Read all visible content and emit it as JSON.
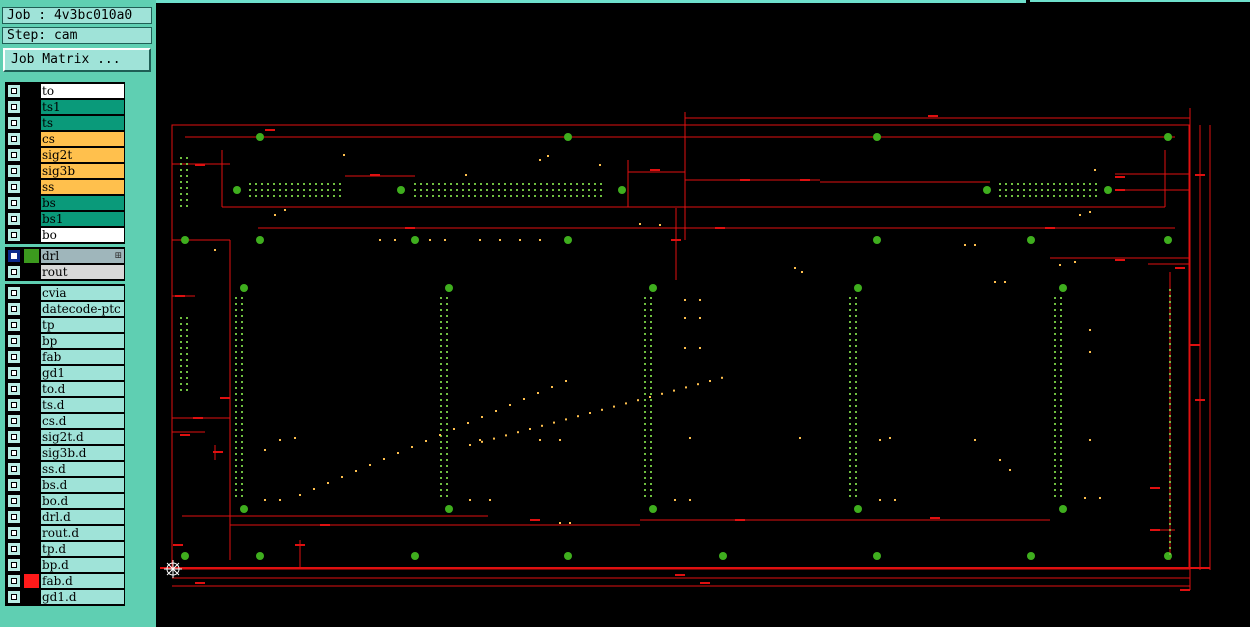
{
  "header": {
    "job_label": "Job : 4v3bc010a0",
    "step_label": "Step: cam",
    "job_matrix_button": "Job Matrix ..."
  },
  "layer_groups": [
    {
      "layers": [
        {
          "name": "to",
          "color": "#ffffff"
        },
        {
          "name": "ts1",
          "color": "#0a9a7a"
        },
        {
          "name": "ts",
          "color": "#0a9a7a"
        },
        {
          "name": "cs",
          "color": "#ffc04d"
        },
        {
          "name": "sig2t",
          "color": "#ffc04d"
        },
        {
          "name": "sig3b",
          "color": "#ffc04d"
        },
        {
          "name": "ss",
          "color": "#ffc04d"
        },
        {
          "name": "bs",
          "color": "#0a9a7a"
        },
        {
          "name": "bs1",
          "color": "#0a9a7a"
        },
        {
          "name": "bo",
          "color": "#ffffff"
        }
      ]
    },
    {
      "layers": [
        {
          "name": "drl",
          "color": "#9fb6bb",
          "selected": true,
          "swatch": "#3c9a1e"
        },
        {
          "name": "rout",
          "color": "#d8d8d8"
        }
      ]
    },
    {
      "layers": [
        {
          "name": "cvia",
          "color": "#9fe3d8"
        },
        {
          "name": "datecode-ptc",
          "color": "#9fe3d8"
        },
        {
          "name": "tp",
          "color": "#9fe3d8"
        },
        {
          "name": "bp",
          "color": "#9fe3d8"
        },
        {
          "name": "fab",
          "color": "#9fe3d8"
        },
        {
          "name": "gd1",
          "color": "#9fe3d8"
        },
        {
          "name": "to.d",
          "color": "#9fe3d8"
        },
        {
          "name": "ts.d",
          "color": "#9fe3d8"
        },
        {
          "name": "cs.d",
          "color": "#9fe3d8"
        },
        {
          "name": "sig2t.d",
          "color": "#9fe3d8"
        },
        {
          "name": "sig3b.d",
          "color": "#9fe3d8"
        },
        {
          "name": "ss.d",
          "color": "#9fe3d8"
        },
        {
          "name": "bs.d",
          "color": "#9fe3d8"
        },
        {
          "name": "bo.d",
          "color": "#9fe3d8"
        },
        {
          "name": "drl.d",
          "color": "#9fe3d8"
        },
        {
          "name": "rout.d",
          "color": "#9fe3d8"
        },
        {
          "name": "tp.d",
          "color": "#9fe3d8"
        },
        {
          "name": "bp.d",
          "color": "#9fe3d8"
        },
        {
          "name": "fab.d",
          "color": "#9fe3d8",
          "swatch": "#ff1a1a"
        },
        {
          "name": "gd1.d",
          "color": "#9fe3d8"
        }
      ]
    }
  ],
  "colors": {
    "panel_bg": "#5fcfb2",
    "canvas_bg": "#000000",
    "dimension_line": "#e01010",
    "pad_green": "#3fae1e",
    "via_dots": "#ffc04d"
  },
  "icons": {
    "origin_marker": "origin-crosshair-icon",
    "expand_marker": "expand-icon"
  }
}
